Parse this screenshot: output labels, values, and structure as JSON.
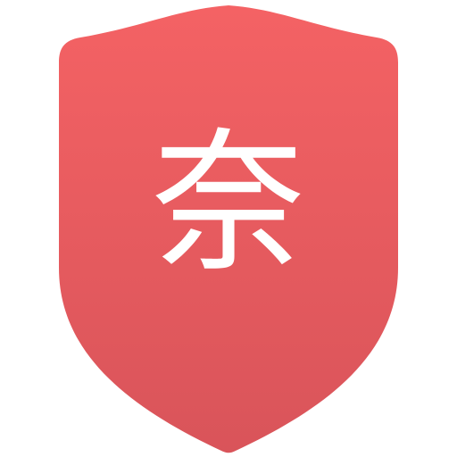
{
  "badge": {
    "character": "奈",
    "colors": {
      "top": "#f46264",
      "bottom": "#d9545a",
      "text": "#ffffff"
    },
    "icon": "shield-icon"
  }
}
